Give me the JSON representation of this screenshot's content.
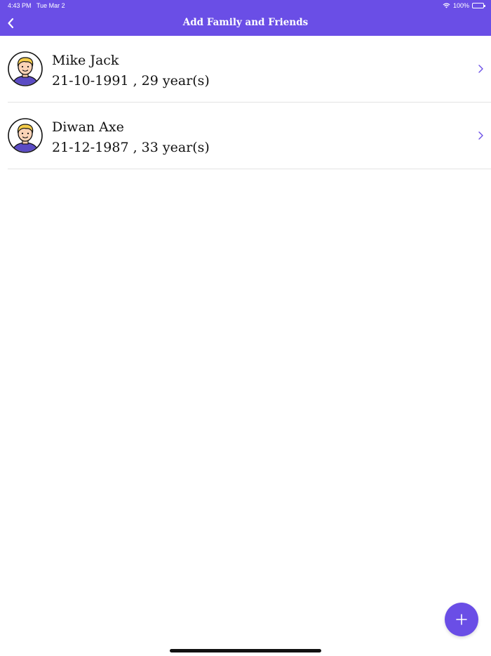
{
  "status_bar": {
    "time": "4:43 PM",
    "date": "Tue Mar 2",
    "battery": "100%"
  },
  "header": {
    "title": "Add Family and Friends"
  },
  "contacts": [
    {
      "name": "Mike Jack",
      "subtitle": "21-10-1991 , 29 year(s)"
    },
    {
      "name": "Diwan Axe",
      "subtitle": "21-12-1987 , 33 year(s)"
    }
  ],
  "colors": {
    "accent": "#6a4ee6",
    "divider": "#e3e3e3",
    "chevron": "#6a4ee6"
  },
  "icons": {
    "back": "chevron-left-icon",
    "row_arrow": "chevron-right-icon",
    "avatar": "avatar-icon",
    "add": "plus-icon"
  }
}
